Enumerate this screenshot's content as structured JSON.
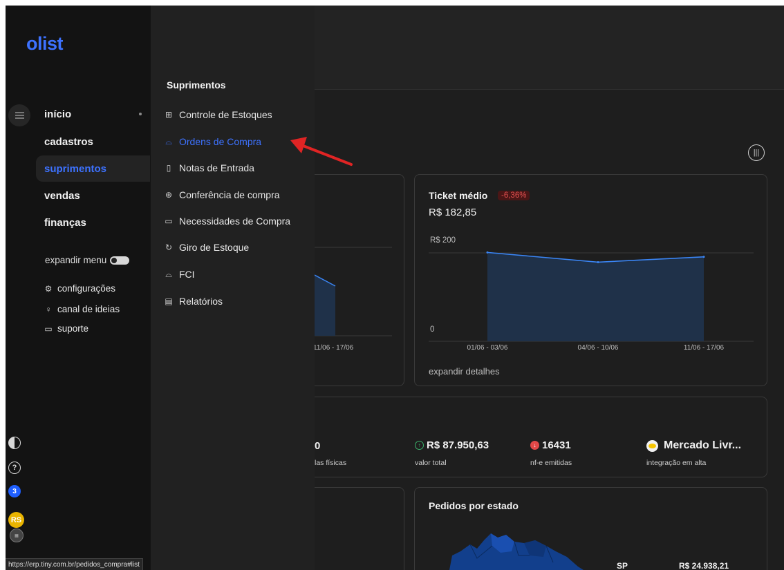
{
  "brand": {
    "logo": "olist"
  },
  "rail": {
    "nav": [
      {
        "label": "início"
      },
      {
        "label": "cadastros"
      },
      {
        "label": "suprimentos"
      },
      {
        "label": "vendas"
      },
      {
        "label": "finanças"
      }
    ],
    "expand_label": "expandir menu",
    "expand_on": false,
    "utilities": [
      {
        "label": "configurações",
        "icon": "gear-icon"
      },
      {
        "label": "canal de ideias",
        "icon": "lightbulb-icon"
      },
      {
        "label": "suporte",
        "icon": "chat-icon"
      }
    ],
    "notification_count": "3",
    "avatar_initials": "RS"
  },
  "submenu": {
    "title": "Suprimentos",
    "items": [
      {
        "label": "Controle de Estoques",
        "icon": "grid-icon"
      },
      {
        "label": "Ordens de Compra",
        "icon": "tray-icon",
        "active": true
      },
      {
        "label": "Notas de Entrada",
        "icon": "document-icon"
      },
      {
        "label": "Conferência de compra",
        "icon": "gift-icon"
      },
      {
        "label": "Necessidades de Compra",
        "icon": "clipboard-icon"
      },
      {
        "label": "Giro de Estoque",
        "icon": "refresh-icon"
      },
      {
        "label": "FCI",
        "icon": "tray-icon"
      },
      {
        "label": "Relatórios",
        "icon": "report-icon"
      }
    ]
  },
  "ticket_card": {
    "title": "Ticket médio",
    "change": "-6,36%",
    "value": "R$ 182,85",
    "link": "expandir detalhes"
  },
  "left_card": {
    "x_tick": "11/06 - 17/06"
  },
  "chart_data": {
    "type": "area",
    "title": "Ticket médio",
    "categories": [
      "01/06 - 03/06",
      "04/06 - 10/06",
      "11/06 - 17/06"
    ],
    "values": [
      201,
      179,
      191
    ],
    "y_tick_labels": [
      "R$ 200",
      "0"
    ],
    "ylim": [
      0,
      200
    ],
    "fill": "#1f3149",
    "line": "#3a85f5"
  },
  "stats": {
    "partial_value": "0",
    "partial_label": "las físicas",
    "total_value": "R$ 87.950,63",
    "total_label": "valor total",
    "nfe_value": "16431",
    "nfe_label": "nf-e emitidas",
    "integration_value": "Mercado Livr...",
    "integration_label": "integração em alta"
  },
  "orders_card": {
    "title": "Pedidos por estado",
    "state": "SP",
    "amount": "R$ 24.938,21"
  },
  "status_bar": {
    "url": "https://erp.tiny.com.br/pedidos_compra#list"
  }
}
